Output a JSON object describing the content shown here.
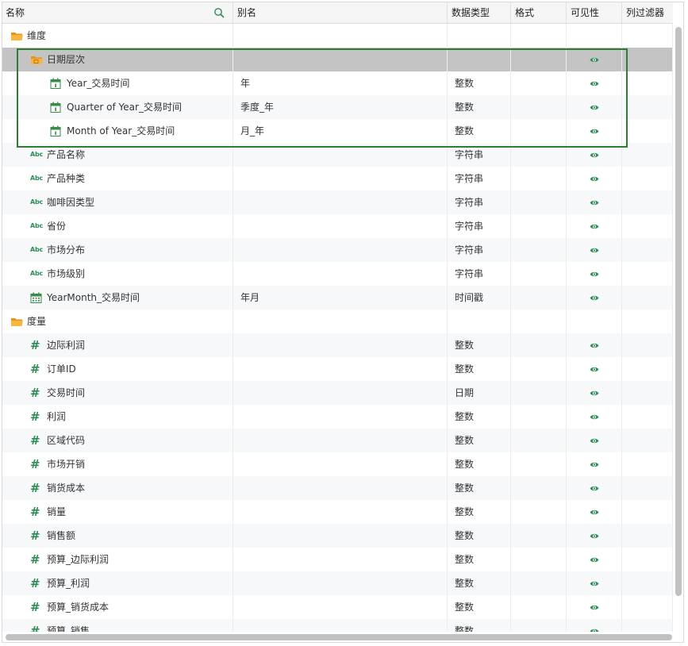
{
  "columns": {
    "name": "名称",
    "alias": "别名",
    "datatype": "数据类型",
    "format": "格式",
    "visible": "可见性",
    "filter": "列过滤器"
  },
  "colors": {
    "accent_green": "#2e8b57",
    "folder_orange": "#f4a21d",
    "selected_row": "#c4c4c4",
    "highlight_border": "#2e7d32"
  },
  "rows": [
    {
      "name": "维度",
      "alias": "",
      "type": "",
      "icon": "folder-icon",
      "level": 0,
      "visible": false
    },
    {
      "name": "日期层次",
      "alias": "",
      "type": "",
      "icon": "date-folder-icon",
      "level": 1,
      "visible": true,
      "selected": true
    },
    {
      "name": "Year_交易时间",
      "alias": "年",
      "type": "整数",
      "icon": "calendar-icon",
      "level": 2,
      "visible": true
    },
    {
      "name": "Quarter of Year_交易时间",
      "alias": "季度_年",
      "type": "整数",
      "icon": "calendar-icon",
      "level": 2,
      "visible": true
    },
    {
      "name": "Month of Year_交易时间",
      "alias": "月_年",
      "type": "整数",
      "icon": "calendar-icon",
      "level": 2,
      "visible": true
    },
    {
      "name": "产品名称",
      "alias": "",
      "type": "字符串",
      "icon": "abc-icon",
      "level": 1,
      "visible": true
    },
    {
      "name": "产品种类",
      "alias": "",
      "type": "字符串",
      "icon": "abc-icon",
      "level": 1,
      "visible": true
    },
    {
      "name": "咖啡因类型",
      "alias": "",
      "type": "字符串",
      "icon": "abc-icon",
      "level": 1,
      "visible": true
    },
    {
      "name": "省份",
      "alias": "",
      "type": "字符串",
      "icon": "abc-icon",
      "level": 1,
      "visible": true
    },
    {
      "name": "市场分布",
      "alias": "",
      "type": "字符串",
      "icon": "abc-icon",
      "level": 1,
      "visible": true
    },
    {
      "name": "市场级别",
      "alias": "",
      "type": "字符串",
      "icon": "abc-icon",
      "level": 1,
      "visible": true
    },
    {
      "name": "YearMonth_交易时间",
      "alias": "年月",
      "type": "时间戳",
      "icon": "timestamp-icon",
      "level": 1,
      "visible": true
    },
    {
      "name": "度量",
      "alias": "",
      "type": "",
      "icon": "folder-icon",
      "level": 0,
      "visible": false
    },
    {
      "name": "边际利润",
      "alias": "",
      "type": "整数",
      "icon": "hash-icon",
      "level": 1,
      "visible": true
    },
    {
      "name": "订单ID",
      "alias": "",
      "type": "整数",
      "icon": "hash-icon",
      "level": 1,
      "visible": true
    },
    {
      "name": "交易时间",
      "alias": "",
      "type": "日期",
      "icon": "hash-icon",
      "level": 1,
      "visible": true
    },
    {
      "name": "利润",
      "alias": "",
      "type": "整数",
      "icon": "hash-icon",
      "level": 1,
      "visible": true
    },
    {
      "name": "区域代码",
      "alias": "",
      "type": "整数",
      "icon": "hash-icon",
      "level": 1,
      "visible": true
    },
    {
      "name": "市场开销",
      "alias": "",
      "type": "整数",
      "icon": "hash-icon",
      "level": 1,
      "visible": true
    },
    {
      "name": "销货成本",
      "alias": "",
      "type": "整数",
      "icon": "hash-icon",
      "level": 1,
      "visible": true
    },
    {
      "name": "销量",
      "alias": "",
      "type": "整数",
      "icon": "hash-icon",
      "level": 1,
      "visible": true
    },
    {
      "name": "销售额",
      "alias": "",
      "type": "整数",
      "icon": "hash-icon",
      "level": 1,
      "visible": true
    },
    {
      "name": "预算_边际利润",
      "alias": "",
      "type": "整数",
      "icon": "hash-icon",
      "level": 1,
      "visible": true
    },
    {
      "name": "预算_利润",
      "alias": "",
      "type": "整数",
      "icon": "hash-icon",
      "level": 1,
      "visible": true
    },
    {
      "name": "预算_销货成本",
      "alias": "",
      "type": "整数",
      "icon": "hash-icon",
      "level": 1,
      "visible": true
    },
    {
      "name": "预算_销售",
      "alias": "",
      "type": "整数",
      "icon": "hash-icon",
      "level": 1,
      "visible": true
    }
  ]
}
